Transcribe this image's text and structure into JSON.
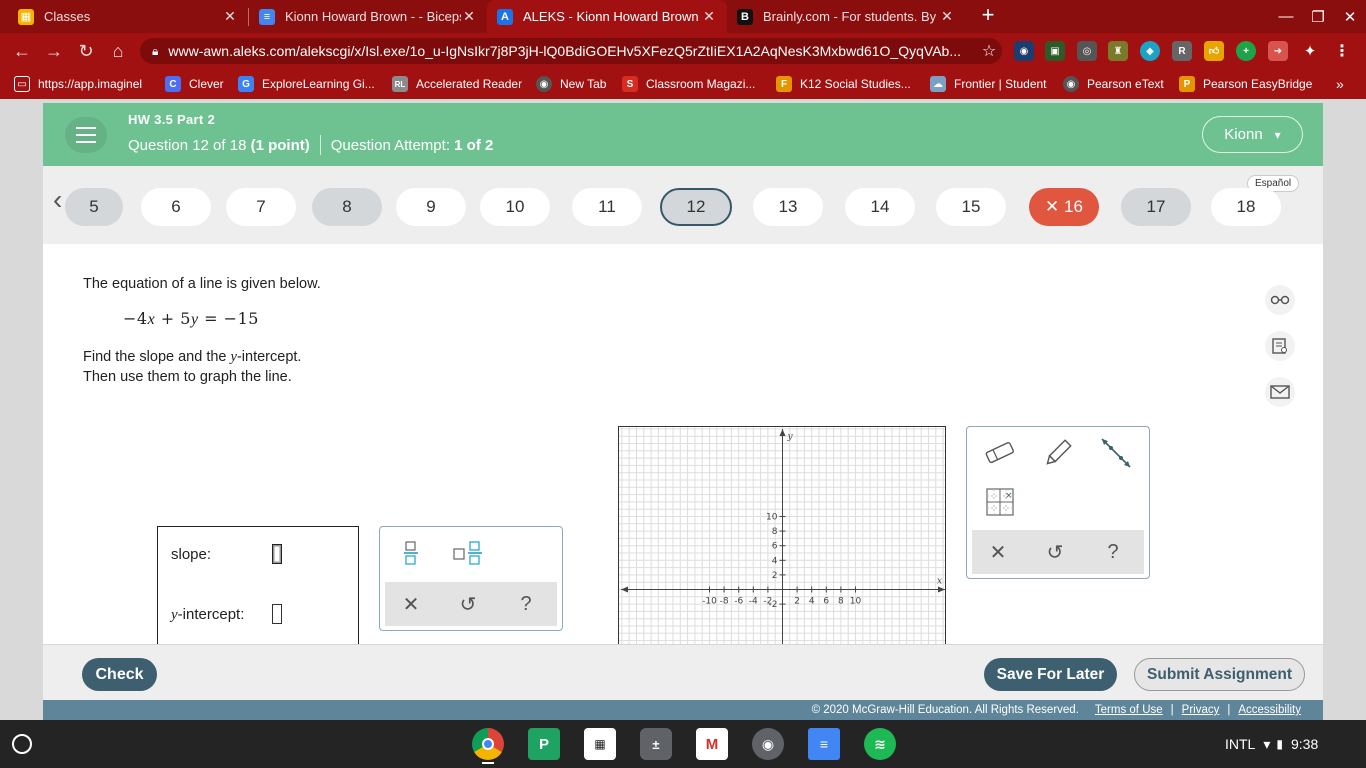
{
  "browser": {
    "tabs": [
      {
        "title": "Classes",
        "icon": "classes-favicon",
        "color": "#f4b400"
      },
      {
        "title": "Kionn Howard Brown - - Biceps/T",
        "icon": "docs-favicon",
        "color": "#4285f4"
      },
      {
        "title": "ALEKS - Kionn Howard Brown - H",
        "icon": "aleks-favicon",
        "color": "#1a73e8"
      },
      {
        "title": "Brainly.com - For students. By st",
        "icon": "brainly-favicon",
        "color": "#111111"
      }
    ],
    "url": "www-awn.aleks.com/alekscgi/x/Isl.exe/1o_u-IgNsIkr7j8P3jH-lQ0BdiGOEHv5XFezQ5rZtIiEX1A2AqNesK3Mxbwd61O_QyqVAb..."
  },
  "bookmarks": [
    {
      "label": "https://app.imaginel",
      "icon": "folder-icon",
      "color": "#a11111"
    },
    {
      "label": "Clever",
      "icon": "clever-icon",
      "color": "#4c6ef5"
    },
    {
      "label": "ExploreLearning Gi...",
      "icon": "explorelearning-icon",
      "color": "#3b82f6"
    },
    {
      "label": "Accelerated Reader",
      "icon": "rl-icon",
      "color": "#8b8b8b"
    },
    {
      "label": "New Tab",
      "icon": "chrome-icon",
      "color": "#555555"
    },
    {
      "label": "Classroom Magazi...",
      "icon": "scholastic-icon",
      "color": "#d62d20"
    },
    {
      "label": "K12 Social Studies...",
      "icon": "k12-icon",
      "color": "#e69500"
    },
    {
      "label": "Frontier | Student",
      "icon": "frontier-icon",
      "color": "#7aa0c4"
    },
    {
      "label": "Pearson eText",
      "icon": "pearson-icon",
      "color": "#555555"
    },
    {
      "label": "Pearson EasyBridge",
      "icon": "pearson-p-icon",
      "color": "#e69500"
    }
  ],
  "header": {
    "assignment": "HW 3.5 Part 2",
    "question_prefix": "Question 12 of 18",
    "points": "(1 point)",
    "attempt_label": "Question Attempt:",
    "attempt_value": "1 of 2",
    "user": "Kionn"
  },
  "nav": {
    "espanol": "Español",
    "questions": [
      {
        "n": "5",
        "state": "answered"
      },
      {
        "n": "6",
        "state": "open"
      },
      {
        "n": "7",
        "state": "open"
      },
      {
        "n": "8",
        "state": "answered"
      },
      {
        "n": "9",
        "state": "open"
      },
      {
        "n": "10",
        "state": "open"
      },
      {
        "n": "11",
        "state": "open"
      },
      {
        "n": "12",
        "state": "current"
      },
      {
        "n": "13",
        "state": "open"
      },
      {
        "n": "14",
        "state": "open"
      },
      {
        "n": "15",
        "state": "open"
      },
      {
        "n": "✕ 16",
        "state": "wrong"
      },
      {
        "n": "17",
        "state": "answered"
      },
      {
        "n": "18",
        "state": "open"
      }
    ]
  },
  "problem": {
    "intro": "The equation of a line is given below.",
    "equation": "−4x + 5y = −15",
    "instruction_1_a": "Find the slope and the ",
    "instruction_1_var": "y",
    "instruction_1_b": "-intercept.",
    "instruction_2": "Then use them to graph the line."
  },
  "answer": {
    "slope_label": "slope:",
    "intercept_var": "y",
    "intercept_label": "-intercept:",
    "slope_value": "",
    "intercept_value": ""
  },
  "graph": {
    "x_axis_label": "x",
    "y_axis_label": "y",
    "x_ticks": [
      "-10",
      "-8",
      "-6",
      "-4",
      "-2",
      "2",
      "4",
      "6",
      "8",
      "10"
    ],
    "y_ticks_pos": [
      "10",
      "8",
      "6",
      "4",
      "2"
    ],
    "y_ticks_neg": [
      "-2"
    ]
  },
  "footer": {
    "check": "Check",
    "save": "Save For Later",
    "submit": "Submit Assignment",
    "copyright": "© 2020 McGraw-Hill Education. All Rights Reserved.",
    "terms": "Terms of Use",
    "privacy": "Privacy",
    "accessibility": "Accessibility"
  },
  "system": {
    "ime": "INTL",
    "time": "9:38"
  }
}
